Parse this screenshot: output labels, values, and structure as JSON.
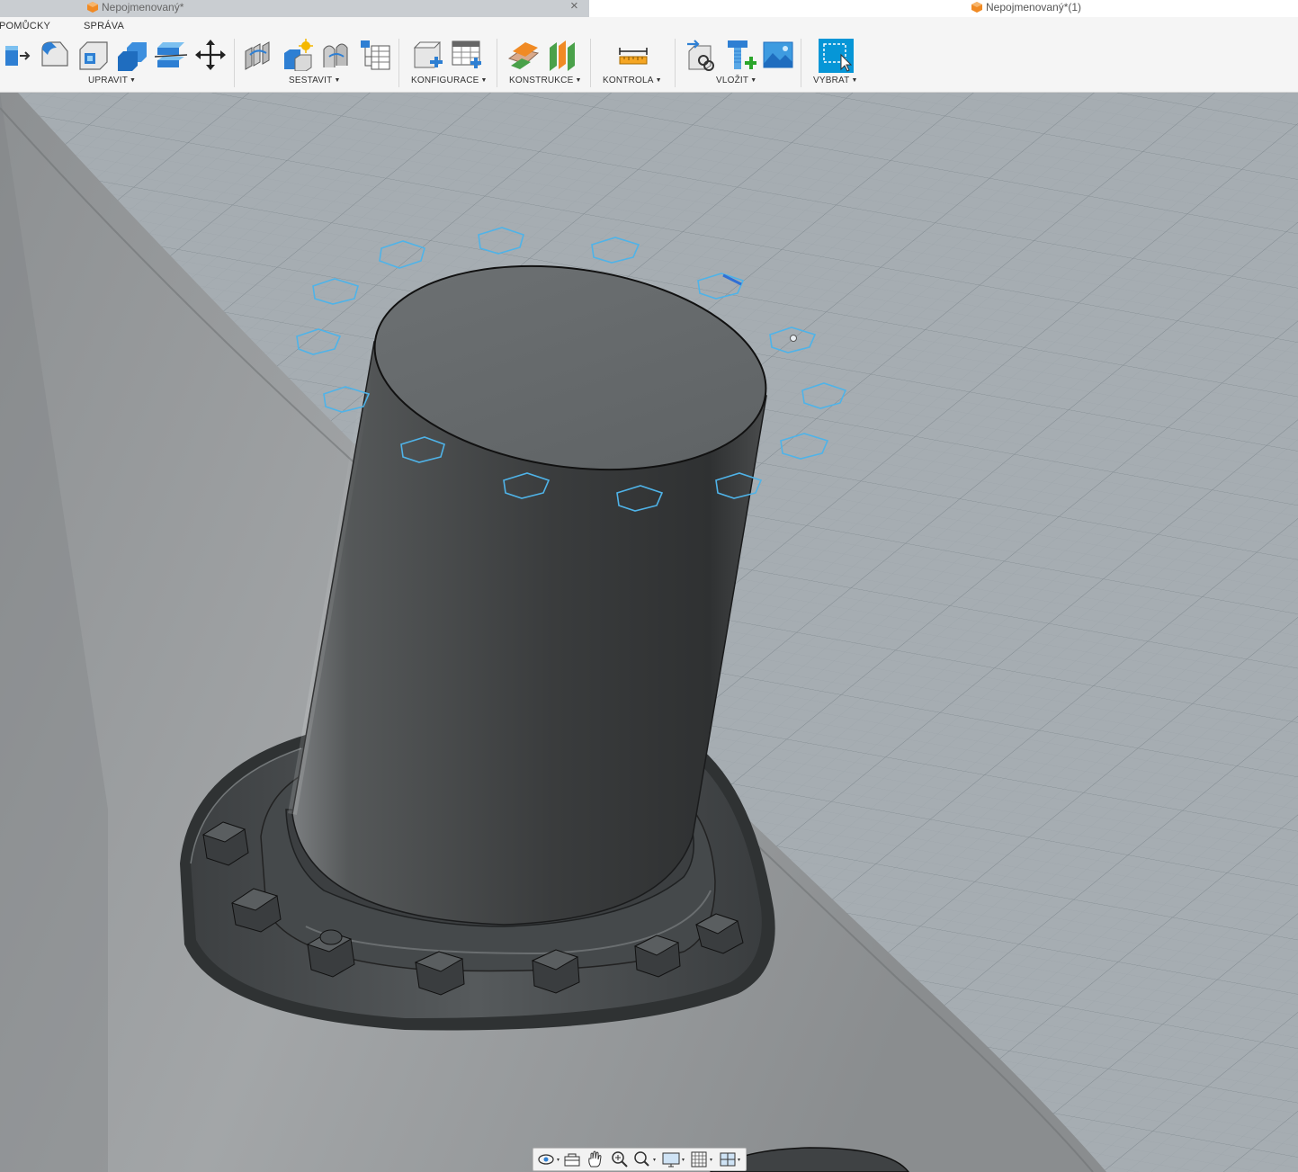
{
  "tabs": [
    {
      "title": "Nepojmenovaný*",
      "active": false
    },
    {
      "title": "Nepojmenovaný*(1)",
      "active": true
    }
  ],
  "workspace_tabs": [
    "POMŮCKY",
    "SPRÁVA"
  ],
  "toolbar_groups": [
    {
      "label": "UPRAVIT",
      "tools": [
        "press-pull-icon",
        "fillet-icon",
        "shell-icon",
        "combine-icon",
        "split-body-icon",
        "move-icon"
      ]
    },
    {
      "label": "SESTAVIT",
      "tools": [
        "joint-icon",
        "new-component-icon",
        "as-built-joint-icon",
        "bill-of-materials-icon"
      ]
    },
    {
      "label": "KONFIGURACE",
      "tools": [
        "configure-icon",
        "parameters-table-icon"
      ]
    },
    {
      "label": "KONSTRUKCE",
      "tools": [
        "offset-plane-icon",
        "midplane-icon"
      ]
    },
    {
      "label": "KONTROLA",
      "tools": [
        "measure-icon"
      ]
    },
    {
      "label": "VLOŽIT",
      "tools": [
        "insert-derive-icon",
        "insert-mcmaster-icon",
        "insert-canvas-icon"
      ]
    },
    {
      "label": "VYBRAT",
      "tools": [
        "select-window-icon"
      ]
    }
  ],
  "navbar_tools": [
    "orbit-icon",
    "look-at-icon",
    "pan-icon",
    "zoom-icon",
    "fit-icon",
    "display-settings-icon",
    "grid-settings-icon",
    "viewports-icon"
  ],
  "colors": {
    "accent": "#0696d7",
    "hole_outline": "#4fb3e8",
    "grid": "#aab2b8",
    "body": "#3f4244"
  }
}
